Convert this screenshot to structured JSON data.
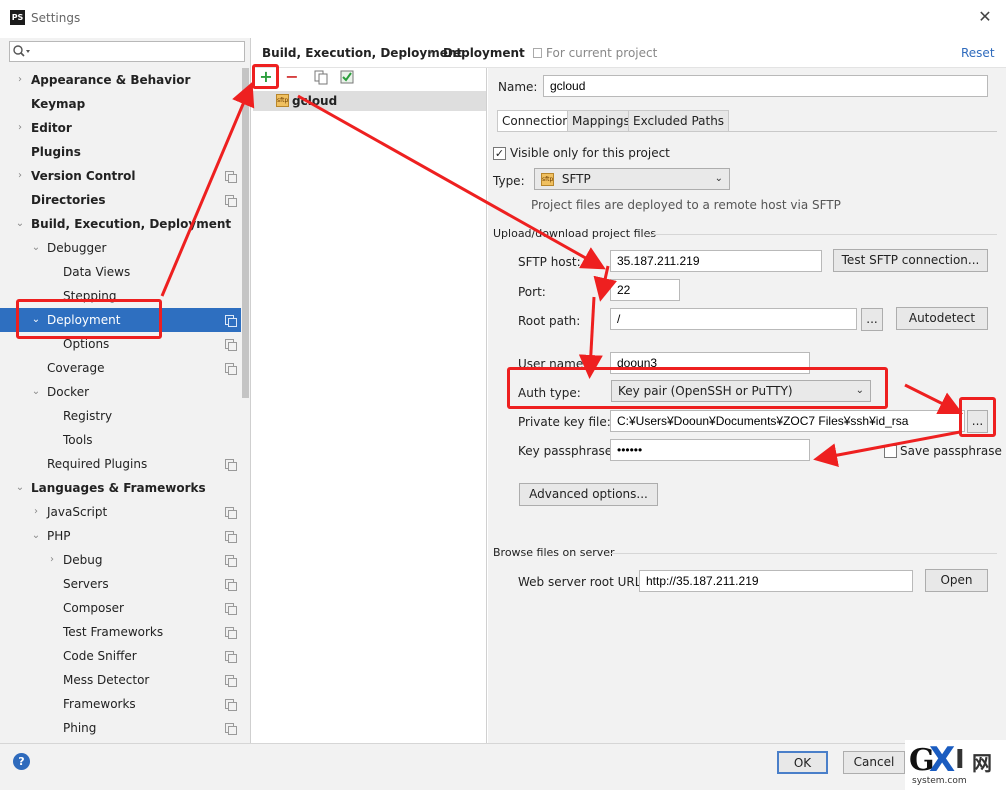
{
  "window": {
    "title": "Settings",
    "app_icon": "PS",
    "close": "✕"
  },
  "search": {
    "placeholder": ""
  },
  "tree": [
    {
      "label": "Appearance & Behavior",
      "chev": "›",
      "bold": true,
      "copy": false
    },
    {
      "label": "Keymap",
      "chev": "",
      "bold": true,
      "copy": false
    },
    {
      "label": "Editor",
      "chev": "›",
      "bold": true,
      "copy": false
    },
    {
      "label": "Plugins",
      "chev": "",
      "bold": true,
      "copy": false
    },
    {
      "label": "Version Control",
      "chev": "›",
      "bold": true,
      "copy": true
    },
    {
      "label": "Directories",
      "chev": "",
      "bold": true,
      "copy": true
    },
    {
      "label": "Build, Execution, Deployment",
      "chev": "⌄",
      "bold": true,
      "copy": false
    },
    {
      "label": "Debugger",
      "chev": "⌄",
      "bold": false,
      "copy": false
    },
    {
      "label": "Data Views",
      "chev": "",
      "bold": false,
      "copy": false
    },
    {
      "label": "Stepping",
      "chev": "",
      "bold": false,
      "copy": false
    },
    {
      "label": "Deployment",
      "chev": "⌄",
      "bold": false,
      "copy": true,
      "selected": true
    },
    {
      "label": "Options",
      "chev": "",
      "bold": false,
      "copy": true
    },
    {
      "label": "Coverage",
      "chev": "",
      "bold": false,
      "copy": true
    },
    {
      "label": "Docker",
      "chev": "⌄",
      "bold": false,
      "copy": false
    },
    {
      "label": "Registry",
      "chev": "",
      "bold": false,
      "copy": false
    },
    {
      "label": "Tools",
      "chev": "",
      "bold": false,
      "copy": false
    },
    {
      "label": "Required Plugins",
      "chev": "",
      "bold": false,
      "copy": true
    },
    {
      "label": "Languages & Frameworks",
      "chev": "⌄",
      "bold": true,
      "copy": false
    },
    {
      "label": "JavaScript",
      "chev": "›",
      "bold": false,
      "copy": true
    },
    {
      "label": "PHP",
      "chev": "⌄",
      "bold": false,
      "copy": true
    },
    {
      "label": "Debug",
      "chev": "›",
      "bold": false,
      "copy": true
    },
    {
      "label": "Servers",
      "chev": "",
      "bold": false,
      "copy": true
    },
    {
      "label": "Composer",
      "chev": "",
      "bold": false,
      "copy": true
    },
    {
      "label": "Test Frameworks",
      "chev": "",
      "bold": false,
      "copy": true
    },
    {
      "label": "Code Sniffer",
      "chev": "",
      "bold": false,
      "copy": true
    },
    {
      "label": "Mess Detector",
      "chev": "",
      "bold": false,
      "copy": true
    },
    {
      "label": "Frameworks",
      "chev": "",
      "bold": false,
      "copy": true
    },
    {
      "label": "Phing",
      "chev": "",
      "bold": false,
      "copy": true
    }
  ],
  "header": {
    "crumb1": "Build, Execution, Deployment",
    "sep": "›",
    "crumb2": "Deployment",
    "scope": "For current project",
    "reset": "Reset"
  },
  "toolbar": {
    "add": "+",
    "remove": "−"
  },
  "server": {
    "icon_text": "sftp",
    "name": "gcloud"
  },
  "form": {
    "name_label": "Name:",
    "name_value": "gcloud",
    "tabs": [
      "Connection",
      "Mappings",
      "Excluded Paths"
    ],
    "visible_only": "Visible only for this project",
    "type_label": "Type:",
    "type_value": "SFTP",
    "type_icon": "sftp",
    "type_hint": "Project files are deployed to a remote host via SFTP",
    "upload_section": "Upload/download project files",
    "host_label": "SFTP host:",
    "host_value": "35.187.211.219",
    "test_btn": "Test SFTP connection...",
    "port_label": "Port:",
    "port_value": "22",
    "root_label": "Root path:",
    "root_value": "/",
    "root_browse": "...",
    "autodetect": "Autodetect",
    "user_label": "User name:",
    "user_value": "dooun3",
    "auth_label": "Auth type:",
    "auth_value": "Key pair (OpenSSH or PuTTY)",
    "key_label": "Private key file:",
    "key_value": "C:¥Users¥Dooun¥Documents¥ZOC7 Files¥ssh¥id_rsa",
    "key_browse": "...",
    "pass_label": "Key passphrase:",
    "pass_value": "••••••",
    "save_pass": "Save passphrase",
    "advanced": "Advanced options...",
    "browse_section": "Browse files on server",
    "web_label": "Web server root URL:",
    "web_value": "http://35.187.211.219",
    "open": "Open"
  },
  "footer": {
    "help": "?",
    "ok": "OK",
    "cancel": "Cancel"
  },
  "watermark": {
    "g": "G",
    "x": "X",
    "i": "I",
    "net": "网",
    "domain": "system.com"
  },
  "colors": {
    "selection": "#2e6fc0",
    "annotation": "#ee2020",
    "link": "#2f6bbd"
  }
}
